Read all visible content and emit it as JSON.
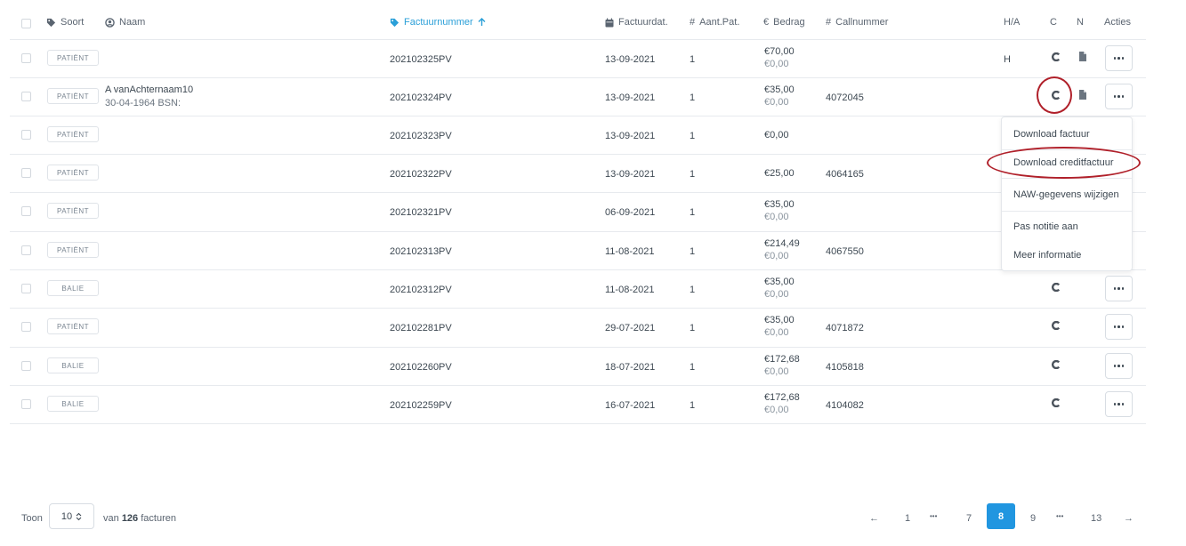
{
  "header": {
    "soort": "Soort",
    "naam": "Naam",
    "factuurnummer": "Factuurnummer",
    "factuurdatum": "Factuurdat.",
    "aantal_pat": "Aant.Pat.",
    "bedrag": "Bedrag",
    "callnummer": "Callnummer",
    "ha": "H/A",
    "c": "C",
    "n": "N",
    "acties": "Acties"
  },
  "rows": [
    {
      "type": "PATIËNT",
      "name_line1": "",
      "name_line2": "",
      "invoice": "202102325PV",
      "date": "13-09-2021",
      "count": "1",
      "amount": "€70,00",
      "amount_sub": "€0,00",
      "call": "",
      "ha": "H",
      "has_c": true,
      "has_n": true,
      "has_action": true
    },
    {
      "type": "PATIËNT",
      "name_line1": "A vanAchternaam10",
      "name_line2": "30-04-1964 BSN:",
      "invoice": "202102324PV",
      "date": "13-09-2021",
      "count": "1",
      "amount": "€35,00",
      "amount_sub": "€0,00",
      "call": "4072045",
      "ha": "",
      "has_c": true,
      "has_n": true,
      "has_action": true
    },
    {
      "type": "PATIËNT",
      "name_line1": "",
      "name_line2": "",
      "invoice": "202102323PV",
      "date": "13-09-2021",
      "count": "1",
      "amount": "€0,00",
      "amount_sub": "",
      "call": "",
      "ha": "",
      "has_c": false,
      "has_n": false,
      "has_action": false
    },
    {
      "type": "PATIËNT",
      "name_line1": "",
      "name_line2": "",
      "invoice": "202102322PV",
      "date": "13-09-2021",
      "count": "1",
      "amount": "€25,00",
      "amount_sub": "",
      "call": "4064165",
      "ha": "",
      "has_c": false,
      "has_n": false,
      "has_action": false
    },
    {
      "type": "PATIËNT",
      "name_line1": "",
      "name_line2": "",
      "invoice": "202102321PV",
      "date": "06-09-2021",
      "count": "1",
      "amount": "€35,00",
      "amount_sub": "€0,00",
      "call": "",
      "ha": "",
      "has_c": false,
      "has_n": false,
      "has_action": false
    },
    {
      "type": "PATIËNT",
      "name_line1": "",
      "name_line2": "",
      "invoice": "202102313PV",
      "date": "11-08-2021",
      "count": "1",
      "amount": "€214,49",
      "amount_sub": "€0,00",
      "call": "4067550",
      "ha": "",
      "has_c": false,
      "has_n": false,
      "has_action": false
    },
    {
      "type": "BALIE",
      "name_line1": "",
      "name_line2": "",
      "invoice": "202102312PV",
      "date": "11-08-2021",
      "count": "1",
      "amount": "€35,00",
      "amount_sub": "€0,00",
      "call": "",
      "ha": "",
      "has_c": true,
      "has_n": false,
      "has_action": true
    },
    {
      "type": "PATIËNT",
      "name_line1": "",
      "name_line2": "",
      "invoice": "202102281PV",
      "date": "29-07-2021",
      "count": "1",
      "amount": "€35,00",
      "amount_sub": "€0,00",
      "call": "4071872",
      "ha": "",
      "has_c": true,
      "has_n": false,
      "has_action": true
    },
    {
      "type": "BALIE",
      "name_line1": "",
      "name_line2": "",
      "invoice": "202102260PV",
      "date": "18-07-2021",
      "count": "1",
      "amount": "€172,68",
      "amount_sub": "€0,00",
      "call": "4105818",
      "ha": "",
      "has_c": true,
      "has_n": false,
      "has_action": true
    },
    {
      "type": "BALIE",
      "name_line1": "",
      "name_line2": "",
      "invoice": "202102259PV",
      "date": "16-07-2021",
      "count": "1",
      "amount": "€172,68",
      "amount_sub": "€0,00",
      "call": "4104082",
      "ha": "",
      "has_c": true,
      "has_n": false,
      "has_action": true
    }
  ],
  "menu": {
    "download_factuur": "Download factuur",
    "download_creditfactuur": "Download creditfactuur",
    "naw_wijzigen": "NAW-gegevens wijzigen",
    "pas_notitie": "Pas notitie aan",
    "meer_informatie": "Meer informatie"
  },
  "footer": {
    "toon_label": "Toon",
    "page_size": "10",
    "van_label": "van",
    "total": "126",
    "facturen_label": "facturen"
  },
  "pagination": {
    "prev": "←",
    "next": "→",
    "ellipsis": "•••",
    "pages": [
      "1",
      "7",
      "8",
      "9",
      "13"
    ],
    "current": "8"
  },
  "colors": {
    "accent": "#2196e0",
    "highlight_circle": "#b0202a"
  }
}
